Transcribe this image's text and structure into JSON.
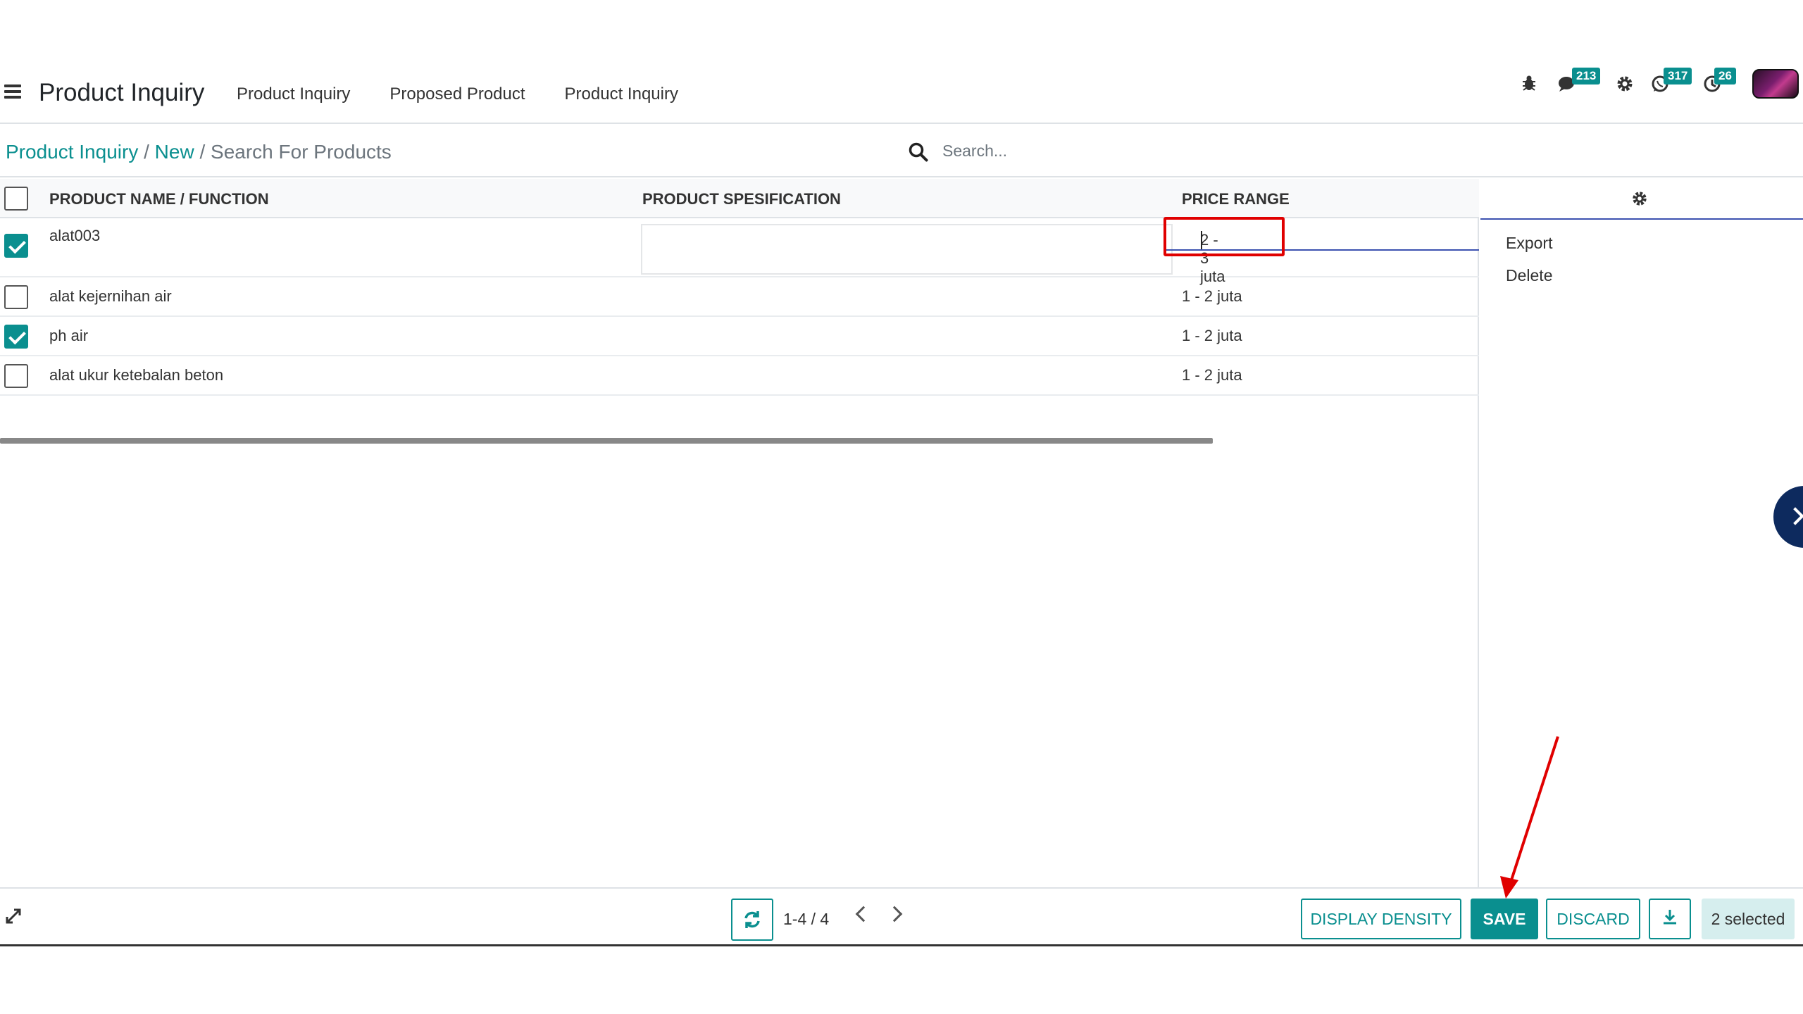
{
  "navbar": {
    "app_title": "Product Inquiry",
    "menu": [
      "Product Inquiry",
      "Proposed Product",
      "Product Inquiry"
    ],
    "systray": {
      "bug_icon": "bug-icon",
      "chat_count": "213",
      "settings_icon": "gear-icon",
      "whatsapp_count": "317",
      "activity_count": "26"
    }
  },
  "control": {
    "breadcrumb": [
      "Product Inquiry",
      "New",
      "Search For Products"
    ],
    "search_placeholder": "Search..."
  },
  "table": {
    "columns": [
      "PRODUCT NAME / FUNCTION",
      "PRODUCT SPESIFICATION",
      "PRICE RANGE"
    ],
    "rows": [
      {
        "name": "alat003",
        "spec": "",
        "price": "2 - 3 juta",
        "checked": true,
        "editing": true
      },
      {
        "name": "alat kejernihan air",
        "spec": "",
        "price": "1 - 2 juta",
        "checked": false
      },
      {
        "name": "ph air",
        "spec": "",
        "price": "1 - 2 juta",
        "checked": true
      },
      {
        "name": "alat ukur ketebalan beton",
        "spec": "",
        "price": "1 - 2 juta",
        "checked": false
      }
    ]
  },
  "side_panel": {
    "actions": [
      "Export",
      "Delete"
    ]
  },
  "footer": {
    "pager": "1-4 / 4",
    "display_density_label": "DISPLAY DENSITY",
    "save_label": "SAVE",
    "discard_label": "DISCARD",
    "selected_label": "2 selected"
  },
  "colors": {
    "accent": "#0a8f8f",
    "annotation": "#e00000",
    "focus_underline": "#3c52b0"
  }
}
